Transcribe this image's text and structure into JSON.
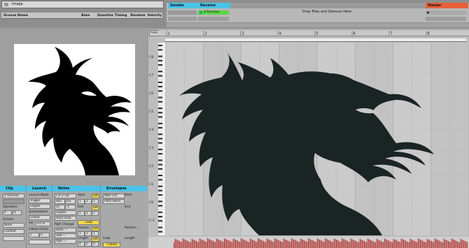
{
  "browser": {
    "search_value": "Image",
    "columns": [
      "Groove Name",
      "Base",
      "Quantize",
      "Timing",
      "Random",
      "Velocity"
    ]
  },
  "session": {
    "tracks": [
      {
        "name": "Sender",
        "color": "#49c3e8"
      },
      {
        "name": "Receive",
        "color": "#49c3e8"
      },
      {
        "name": "Master",
        "color": "#e8603a"
      }
    ],
    "receive_clip": "4 Receive",
    "drop_text": "Drop Files and Devices Here"
  },
  "piano_roll": {
    "fold_label": "Fold",
    "ruler_marks": [
      "1",
      "2",
      "3",
      "4",
      "5",
      "6",
      "7",
      "8"
    ],
    "note_labels": [
      "C8",
      "C7",
      "C6",
      "C5",
      "C4",
      "C3",
      "C2",
      "C1",
      "C0",
      "C-1",
      "C-2"
    ],
    "note_color": "#1a2422"
  },
  "clip_view": {
    "clip": {
      "title": "Clip",
      "receive": "4 Receive",
      "signature_label": "Signature",
      "signature": [
        "4",
        "4"
      ],
      "groove_label": "Groove",
      "groove_value": "None",
      "commit_label": "Commit"
    },
    "launch": {
      "title": "Launch",
      "launch_mode_label": "Launch Mode",
      "launch_mode": "Trigger",
      "legato": "Legato",
      "quantization_label": "Quantization",
      "quantization": "Global",
      "vel_label": "Vel",
      "vel_value": "0.0 %",
      "follow_label": "Follow Action",
      "follow_values": [
        "1",
        "0"
      ]
    },
    "notes": {
      "title": "Notes",
      "note_value": "C#-2-G8",
      "rev": "Rev",
      "inv": "Inv",
      "x2": "x2",
      "div2": ":2",
      "legato": "Legato",
      "dupl_loop": "Dupl.Loop",
      "start_label": "Start",
      "set_label": "Set",
      "end_label": "End",
      "loop_label": "Loop",
      "position_label": "Position",
      "length_label": "Length",
      "pgm_change_label": "Pgm Change",
      "bank": "Bank ---",
      "sub": "Sub ---",
      "pgm": "Pgm ---",
      "start_vals": [
        "1",
        "1",
        "1"
      ],
      "end_vals": [
        "5",
        "1",
        "1"
      ],
      "position_vals": [
        "1",
        "1",
        "1"
      ],
      "length_vals": [
        "4",
        "0",
        "0"
      ]
    },
    "envelopes": {
      "title": "Envelopes",
      "device": "MIDI Ctrl",
      "control": "Pitch Bend",
      "start_label": "Start",
      "end_label": "End",
      "loop_label": "Loop",
      "position_label": "Position",
      "length_label": "Length",
      "linked": "Linked"
    }
  }
}
